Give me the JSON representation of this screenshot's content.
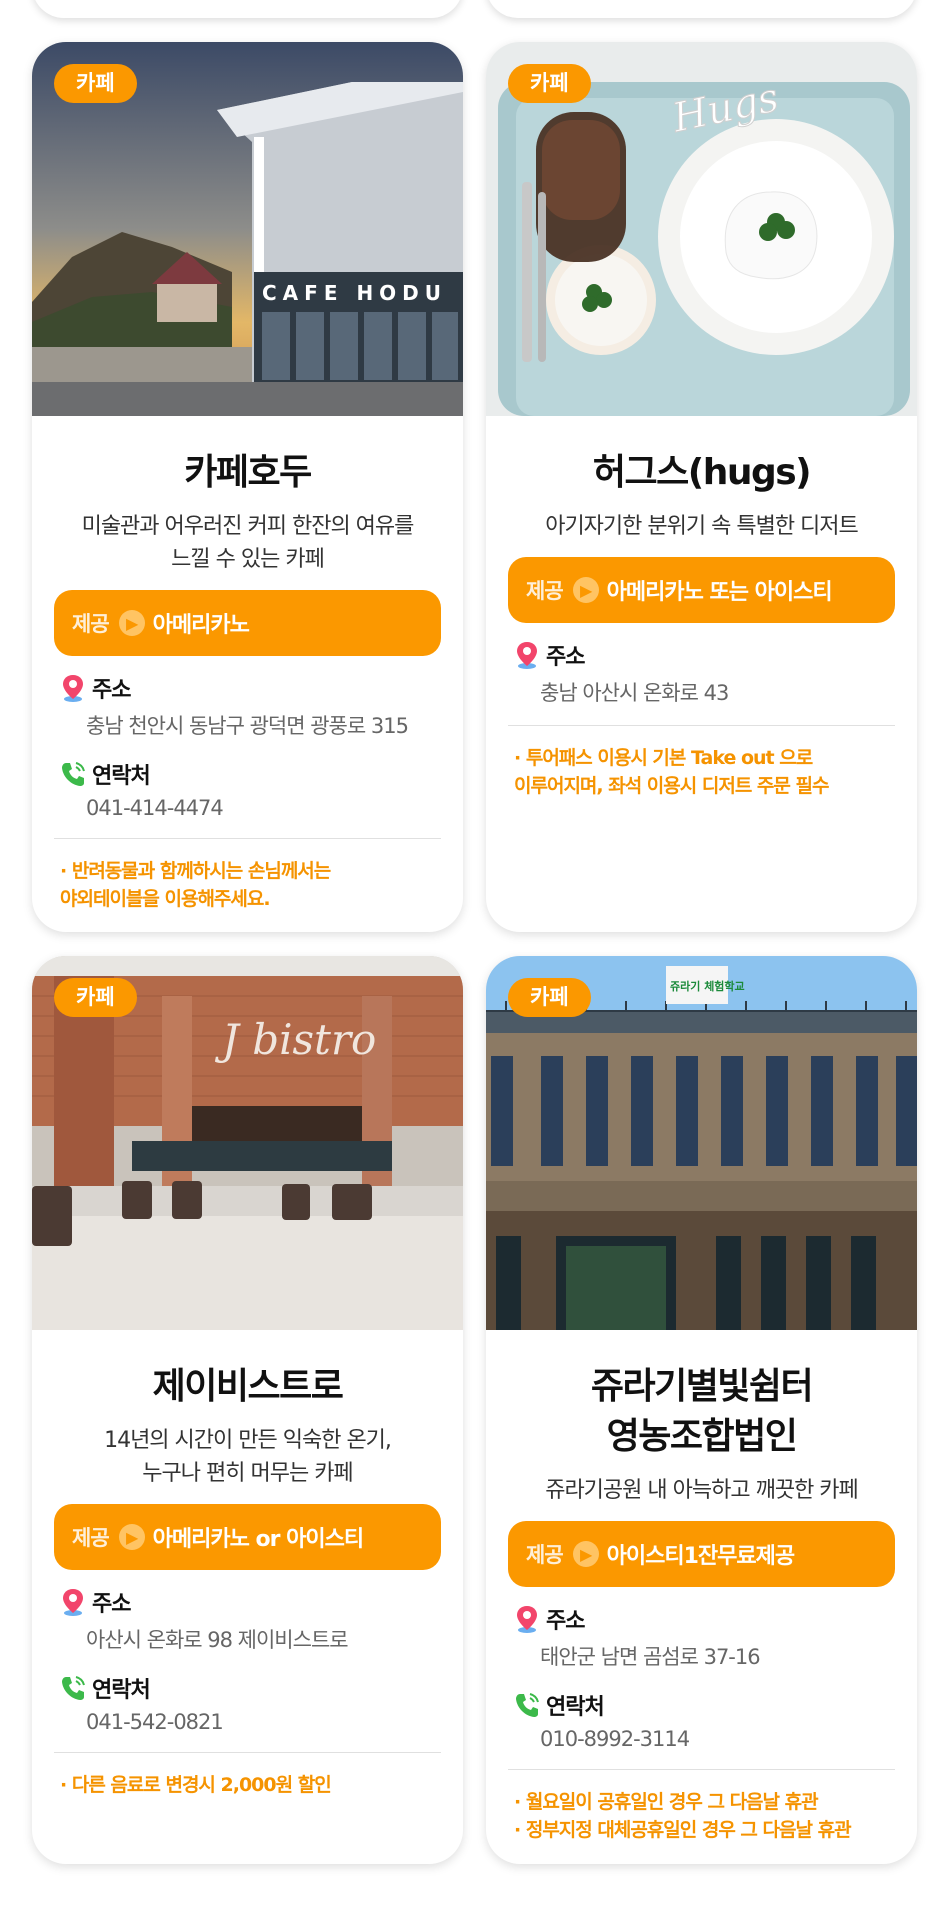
{
  "cards": [
    {
      "badge": "카페",
      "title": "카페호두",
      "desc": "미술관과 어우러진 커피 한잔의 여유를\n느낄 수 있는 카페",
      "offer_label": "제공",
      "offer_value": "아메리카노",
      "address_label": "주소",
      "address": "충남 천안시 동남구 광덕면 광풍로 315",
      "contact_label": "연락처",
      "contact": "041-414-4474",
      "notes": [
        "· 반려동물과 함께하시는 손님께서는\n  야외테이블을 이용해주세요."
      ]
    },
    {
      "badge": "카페",
      "title": "허그스(hugs)",
      "desc": "아기자기한 분위기 속 특별한 디저트",
      "offer_label": "제공",
      "offer_value": "아메리카노 또는 아이스티",
      "address_label": "주소",
      "address": "충남 아산시 온화로 43",
      "notes": [
        "· 투어패스 이용시 기본 Take out 으로\n  이루어지며, 좌석 이용시 디저트 주문 필수"
      ]
    },
    {
      "badge": "카페",
      "title": "제이비스트로",
      "desc": "14년의 시간이 만든 익숙한 온기,\n누구나 편히 머무는 카페",
      "offer_label": "제공",
      "offer_value": "아메리카노 or 아이스티",
      "address_label": "주소",
      "address": "아산시 온화로 98 제이비스트로",
      "contact_label": "연락처",
      "contact": "041-542-0821",
      "notes": [
        "· 다른 음료로 변경시 2,000원 할인"
      ]
    },
    {
      "badge": "카페",
      "title": "쥬라기별빛쉼터\n영농조합법인",
      "desc": "쥬라기공원 내 아늑하고 깨끗한 카페",
      "offer_label": "제공",
      "offer_value": "아이스티1잔무료제공",
      "address_label": "주소",
      "address": "태안군 남면 곰섬로 37-16",
      "contact_label": "연락처",
      "contact": "010-8992-3114",
      "notes": [
        "· 월요일이 공휴일인 경우 그 다음날 휴관",
        "· 정부지정 대체공휴일인 경우 그 다음날 휴관"
      ]
    }
  ],
  "image_text": {
    "hodu_sign": "CAFE  HODU",
    "hugs_sign": "Hugs",
    "jbistro_sign": "J bistro",
    "jurassic_sign": "쥬라기 체험학교"
  },
  "colors": {
    "accent": "#fb9800",
    "note": "#f59300"
  },
  "icons": {
    "offer_arrow": "chevron-right-icon",
    "address": "map-pin-icon",
    "contact": "phone-icon"
  }
}
